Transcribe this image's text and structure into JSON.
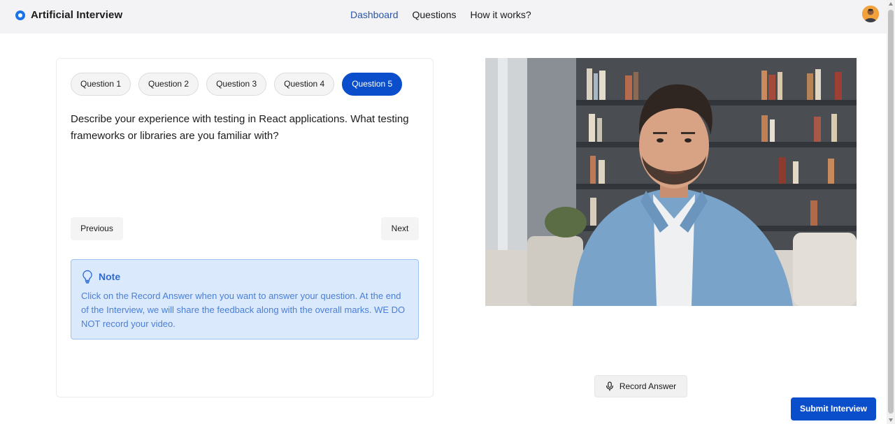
{
  "app": {
    "title": "Artificial Interview"
  },
  "nav": {
    "items": [
      {
        "label": "Dashboard",
        "active": true
      },
      {
        "label": "Questions",
        "active": false
      },
      {
        "label": "How it works?",
        "active": false
      }
    ]
  },
  "interview": {
    "tabs": [
      {
        "label": "Question 1",
        "active": false
      },
      {
        "label": "Question 2",
        "active": false
      },
      {
        "label": "Question 3",
        "active": false
      },
      {
        "label": "Question 4",
        "active": false
      },
      {
        "label": "Question 5",
        "active": true
      }
    ],
    "question": "Describe your experience with testing in React applications. What testing frameworks or libraries are you familiar with?",
    "previous_label": "Previous",
    "next_label": "Next",
    "note": {
      "title": "Note",
      "body": "Click on the Record Answer when you want to answer your question. At the end of the Interview, we will share the feedback along with the overall marks. WE DO NOT record your video."
    }
  },
  "video": {
    "record_label": "Record Answer"
  },
  "actions": {
    "submit_label": "Submit Interview"
  },
  "icons": {
    "logo": "app-logo-icon",
    "note": "lightbulb-icon",
    "record": "microphone-icon"
  },
  "colors": {
    "accent": "#0b4ecb",
    "nav_active": "#2b56a8",
    "note_bg": "#dbe9fc",
    "note_text": "#4a7fd7"
  }
}
